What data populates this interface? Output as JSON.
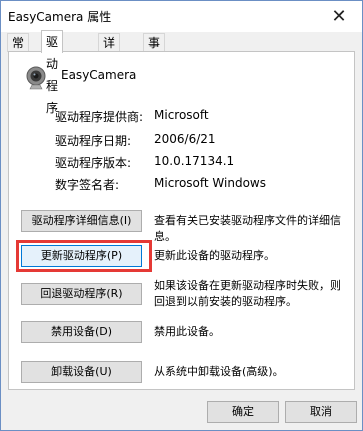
{
  "window": {
    "title": "EasyCamera 属性"
  },
  "tabs": [
    {
      "label": "常规"
    },
    {
      "label": "驱动程序"
    },
    {
      "label": "详细信息"
    },
    {
      "label": "事件"
    }
  ],
  "device": {
    "name": "EasyCamera",
    "icon": "webcam-icon"
  },
  "info": [
    {
      "label": "驱动程序提供商:",
      "value": "Microsoft"
    },
    {
      "label": "驱动程序日期:",
      "value": "2006/6/21"
    },
    {
      "label": "驱动程序版本:",
      "value": "10.0.17134.1"
    },
    {
      "label": "数字签名者:",
      "value": "Microsoft Windows"
    }
  ],
  "actions": [
    {
      "button": "驱动程序详细信息(I)",
      "description": "查看有关已安装驱动程序文件的详细信息。"
    },
    {
      "button": "更新驱动程序(P)",
      "description": "更新此设备的驱动程序。"
    },
    {
      "button": "回退驱动程序(R)",
      "description": "如果该设备在更新驱动程序时失败，则回退到以前安装的驱动程序。"
    },
    {
      "button": "禁用设备(D)",
      "description": "禁用此设备。"
    },
    {
      "button": "卸载设备(U)",
      "description": "从系统中卸载设备(高级)。"
    }
  ],
  "footer": {
    "ok": "确定",
    "cancel": "取消"
  },
  "colors": {
    "highlight": "#e53935",
    "focus_border": "#0078d7"
  }
}
